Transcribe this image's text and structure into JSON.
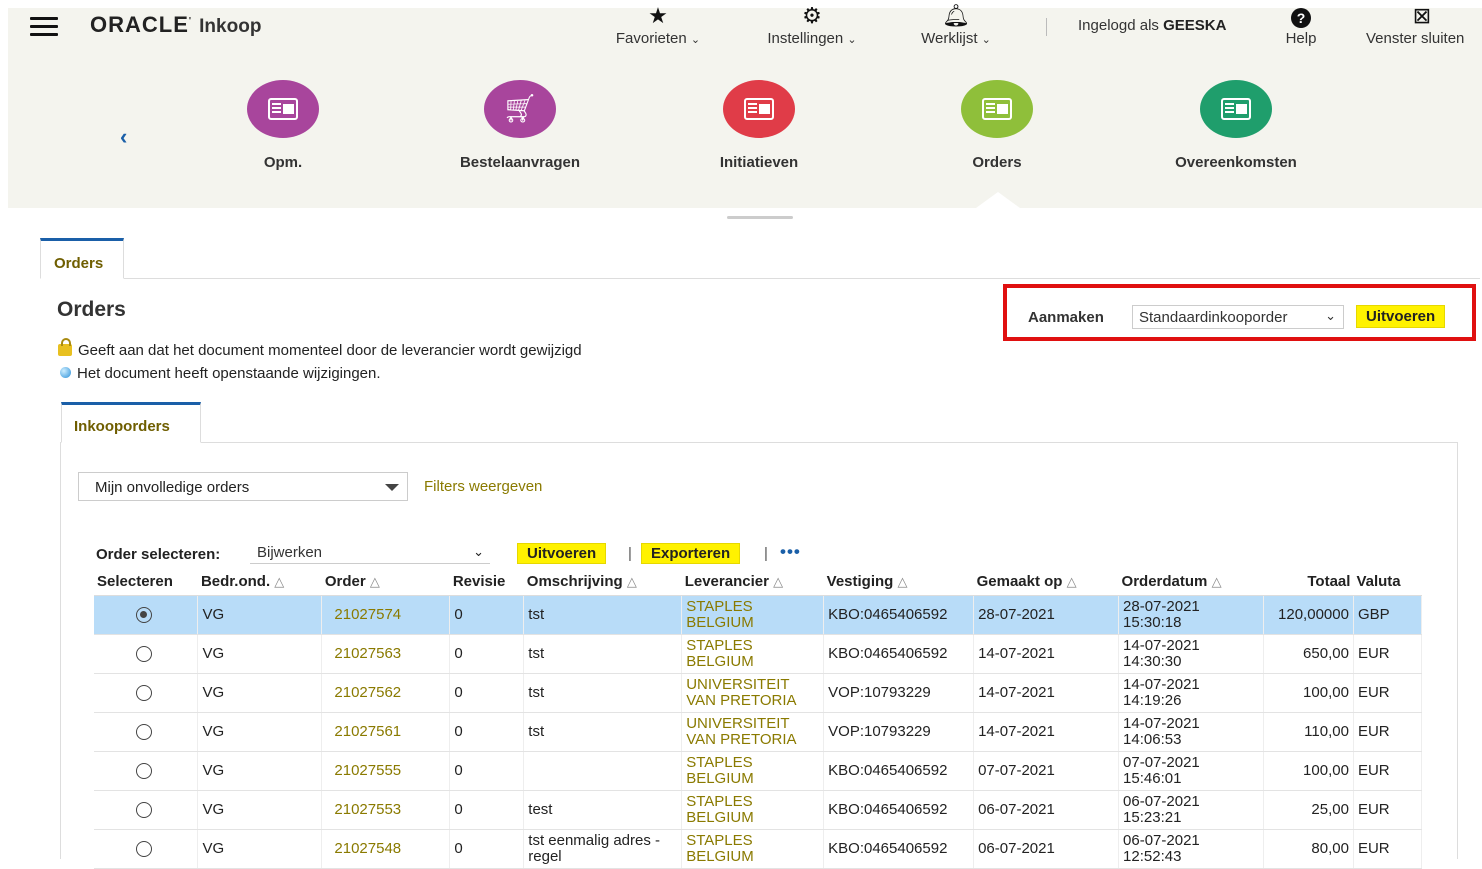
{
  "header": {
    "brand": "ORACLE",
    "app": "Inkoop",
    "nav": [
      {
        "label": "Favorieten",
        "icon": "star-icon"
      },
      {
        "label": "Instellingen",
        "icon": "gear-icon"
      },
      {
        "label": "Werklijst",
        "icon": "bell-icon"
      }
    ],
    "user_prefix": "Ingelogd als",
    "user_name": "GEESKA",
    "help": "Help",
    "close_window": "Venster sluiten"
  },
  "springboard": [
    {
      "label": "Opm.",
      "color": "#a8459c"
    },
    {
      "label": "Bestelaanvragen",
      "color": "#a8459c"
    },
    {
      "label": "Initiatieven",
      "color": "#e03c48"
    },
    {
      "label": "Orders",
      "color": "#8fbf3a"
    },
    {
      "label": "Overeenkomsten",
      "color": "#1f9e6c"
    }
  ],
  "page": {
    "tab": "Orders",
    "title": "Orders",
    "create_label": "Aanmaken",
    "create_value": "Standaardinkooporder",
    "create_go": "Uitvoeren",
    "legend_lock": "Geeft aan dat het document momenteel door de leverancier wordt gewijzigd",
    "legend_pending": "Het document heeft openstaande wijzigingen.",
    "subtab": "Inkooporders",
    "filter_value": "Mijn onvolledige orders",
    "filters_link": "Filters weergeven"
  },
  "table_toolbar": {
    "select_label": "Order selecteren:",
    "select_value": "Bijwerken",
    "go": "Uitvoeren",
    "export": "Exporteren",
    "more": "•••"
  },
  "columns": [
    "Selecteren",
    "Bedr.ond.",
    "Order",
    "Revisie",
    "Omschrijving",
    "Leverancier",
    "Vestiging",
    "Gemaakt op",
    "Orderdatum",
    "Totaal",
    "Valuta"
  ],
  "rows": [
    {
      "bu": "VG",
      "order": "21027574",
      "rev": "0",
      "desc": "tst",
      "supplier": "STAPLES BELGIUM",
      "site": "KBO:0465406592",
      "created": "28-07-2021",
      "date": "28-07-2021",
      "time": "15:30:18",
      "total": "120,00000",
      "currency": "GBP",
      "selected": true
    },
    {
      "bu": "VG",
      "order": "21027563",
      "rev": "0",
      "desc": "tst",
      "supplier": "STAPLES BELGIUM",
      "site": "KBO:0465406592",
      "created": "14-07-2021",
      "date": "14-07-2021",
      "time": "14:30:30",
      "total": "650,00",
      "currency": "EUR",
      "selected": false
    },
    {
      "bu": "VG",
      "order": "21027562",
      "rev": "0",
      "desc": "tst",
      "supplier": "UNIVERSITEIT VAN PRETORIA",
      "site": "VOP:10793229",
      "created": "14-07-2021",
      "date": "14-07-2021",
      "time": "14:19:26",
      "total": "100,00",
      "currency": "EUR",
      "selected": false
    },
    {
      "bu": "VG",
      "order": "21027561",
      "rev": "0",
      "desc": "tst",
      "supplier": "UNIVERSITEIT VAN PRETORIA",
      "site": "VOP:10793229",
      "created": "14-07-2021",
      "date": "14-07-2021",
      "time": "14:06:53",
      "total": "110,00",
      "currency": "EUR",
      "selected": false
    },
    {
      "bu": "VG",
      "order": "21027555",
      "rev": "0",
      "desc": "",
      "supplier": "STAPLES BELGIUM",
      "site": "KBO:0465406592",
      "created": "07-07-2021",
      "date": "07-07-2021",
      "time": "15:46:01",
      "total": "100,00",
      "currency": "EUR",
      "selected": false
    },
    {
      "bu": "VG",
      "order": "21027553",
      "rev": "0",
      "desc": "test",
      "supplier": "STAPLES BELGIUM",
      "site": "KBO:0465406592",
      "created": "06-07-2021",
      "date": "06-07-2021",
      "time": "15:23:21",
      "total": "25,00",
      "currency": "EUR",
      "selected": false
    },
    {
      "bu": "VG",
      "order": "21027548",
      "rev": "0",
      "desc": "tst eenmalig adres - regel",
      "supplier": "STAPLES BELGIUM",
      "site": "KBO:0465406592",
      "created": "06-07-2021",
      "date": "06-07-2021",
      "time": "12:52:43",
      "total": "80,00",
      "currency": "EUR",
      "selected": false
    }
  ]
}
